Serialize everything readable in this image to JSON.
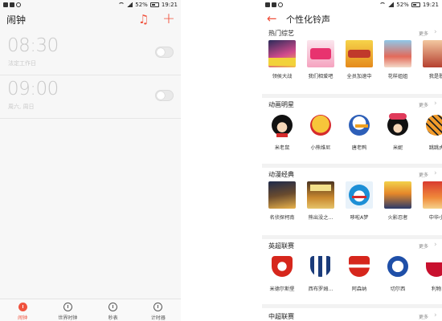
{
  "left": {
    "status": {
      "battery": "52%",
      "time": "19:21"
    },
    "header": {
      "title": "闹钟"
    },
    "alarms": [
      {
        "time": "08:30",
        "sub": "法定工作日"
      },
      {
        "time": "09:00",
        "sub": "周六, 周日"
      }
    ],
    "tabs": [
      {
        "label": "闹钟"
      },
      {
        "label": "世界时钟"
      },
      {
        "label": "秒表"
      },
      {
        "label": "计时器"
      }
    ]
  },
  "right": {
    "status": {
      "battery": "52%",
      "time": "19:21"
    },
    "header": {
      "title": "个性化铃声"
    },
    "more_label": "更多",
    "sections": [
      {
        "title": "热门综艺",
        "items": [
          "领侯大战",
          "我们相爱吧",
          "全员加速中",
          "花样姐姐",
          "我是歌"
        ]
      },
      {
        "title": "动画明星",
        "items": [
          "米老鼠",
          "小熊维尼",
          "唐老鸭",
          "米妮",
          "跳跳虎"
        ]
      },
      {
        "title": "动漫经典",
        "items": [
          "名侦探柯南",
          "熊出没之...",
          "哆啦A梦",
          "火影忍者",
          "中华小"
        ]
      },
      {
        "title": "英超联赛",
        "items": [
          "米德尔斯堡",
          "西布罗姆...",
          "阿森纳",
          "切尔西",
          "利物"
        ]
      },
      {
        "title": "中超联赛",
        "items": []
      }
    ]
  },
  "colors": {
    "accent": "#f0533e"
  }
}
